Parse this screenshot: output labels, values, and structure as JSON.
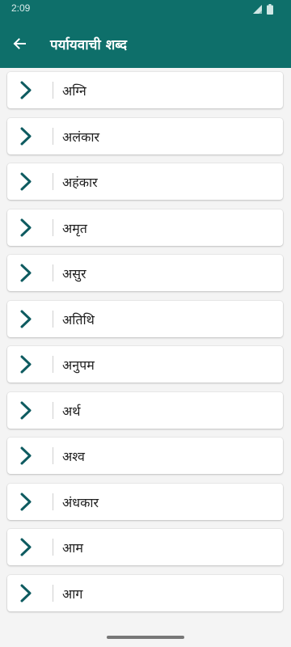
{
  "status": {
    "time": "2:09"
  },
  "app_bar": {
    "title": "पर्यायवाची शब्द"
  },
  "words": [
    "अग्नि",
    "अलंकार",
    "अहंकार",
    "अमृत",
    "असुर",
    "अतिथि",
    "अनुपम",
    "अर्थ",
    "अश्व",
    "अंधकार",
    "आम",
    "आग"
  ],
  "colors": {
    "primary": "#0e6f6a",
    "chevron": "#0e5b60"
  }
}
